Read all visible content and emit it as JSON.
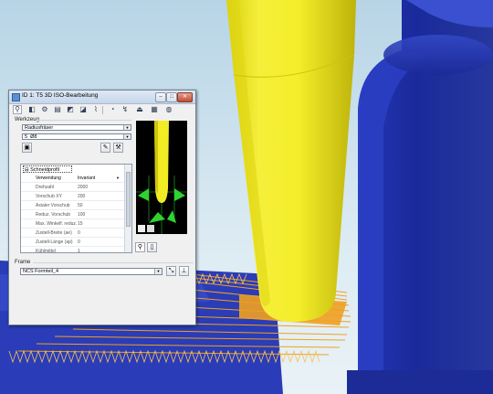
{
  "dialog": {
    "title": "ID 1: T5 3D ISO-Bearbeitung",
    "werkzeug_label": "Werkzeug",
    "tool_type_value": "Radiusfräser",
    "tool_index": "5",
    "tool_size": "Ø8",
    "schneidprofil_label": "Schneidprofil",
    "properties": [
      {
        "name": "Verwendung",
        "value": "Invariant"
      },
      {
        "name": "Drehzahl",
        "value": "2000"
      },
      {
        "name": "Vorschub XY",
        "value": "200"
      },
      {
        "name": "Axialer Vorschub",
        "value": "50"
      },
      {
        "name": "Reduz. Vorschub",
        "value": "100"
      },
      {
        "name": "Max. Winkelf. reduz.",
        "value": "15"
      },
      {
        "name": "Zustell-Breite (ae)",
        "value": "0"
      },
      {
        "name": "Zustell-Länge (ap)",
        "value": "0"
      },
      {
        "name": "Kühlmittel",
        "value": "1"
      }
    ],
    "frame_label": "Frame",
    "frame_value": "NCS Formteil_4"
  },
  "colors": {
    "part_blue": "#1e2fa8",
    "tool_yellow": "#f2ec25",
    "toolpath_orange": "#f0a020",
    "preview_green": "#2fd22f",
    "background_light": "#cfe3ef"
  },
  "icons": [
    "tool-icon",
    "stock-icon",
    "strategy-icon",
    "parameters-icon",
    "limits-icon",
    "macro-icon",
    "linking-icon",
    "check-icon",
    "axis-icon",
    "nc-output-icon",
    "properties-icon",
    "settings-icon",
    "cube-icon",
    "frame-edit-icon"
  ]
}
